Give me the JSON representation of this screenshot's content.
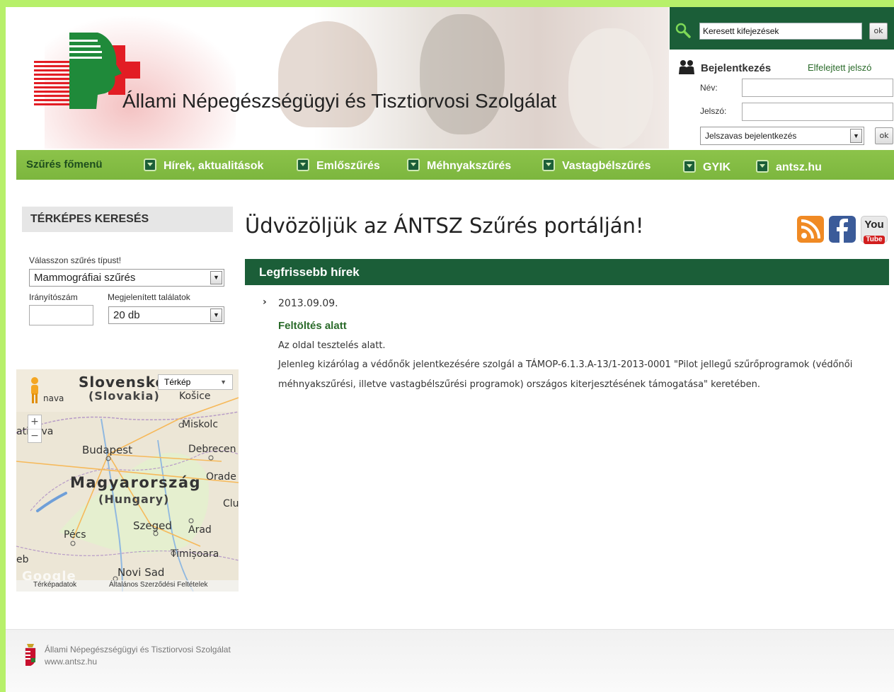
{
  "header": {
    "title": "Állami Népegészségügyi és Tisztiorvosi Szolgálat"
  },
  "search": {
    "value": "Keresett kifejezések",
    "button": "ok"
  },
  "login": {
    "title": "Bejelentkezés",
    "forgot_link": "Elfelejtett jelszó",
    "name_label": "Név:",
    "password_label": "Jelszó:",
    "method_selected": "Jelszavas bejelentkezés",
    "button": "ok"
  },
  "nav": {
    "main_label": "Szűrés főmenü",
    "items": [
      {
        "label": "Hírek, aktualitások"
      },
      {
        "label": "Emlőszűrés"
      },
      {
        "label": "Méhnyakszűrés"
      },
      {
        "label": "Vastagbélszűrés"
      },
      {
        "label": "GYIK"
      },
      {
        "label": "antsz.hu"
      }
    ]
  },
  "sidebar": {
    "title": "TÉRKÉPES KERESÉS",
    "type_label": "Válasszon szűrés típust!",
    "type_selected": "Mammográfiai szűrés",
    "zip_label": "Irányítószám",
    "results_label": "Megjelenített találatok",
    "results_selected": "20 db"
  },
  "map": {
    "type_selected": "Térkép",
    "zoom_in": "+",
    "zoom_out": "−",
    "labels": {
      "slovakia": "Slovensko",
      "slovakia_en": "(Slovakia)",
      "kosice": "Košice",
      "nava": "nava",
      "atava": "ati  ava",
      "miskolc": "Miskolc",
      "budapest": "Budapest",
      "debrecen": "Debrecen",
      "oradea": "Orade",
      "hungary": "Magyarország",
      "hungary_en": "(Hungary)",
      "cluj": "Clu",
      "szeged": "Szeged",
      "arad": "Arad",
      "pecs": "Pécs",
      "timisoara": "Timișoara",
      "eb": "eb",
      "novisad": "Novi Sad",
      "google": "Google"
    },
    "footer_data": "Térképadatok",
    "footer_terms": "Általános Szerződési Feltételek"
  },
  "main": {
    "welcome": "Üdvözöljük az ÁNTSZ Szűrés portálján!",
    "news_header": "Legfrissebb hírek",
    "news": {
      "date": "2013.09.09.",
      "title": "Feltöltés alatt",
      "line1": "Az oldal tesztelés alatt.",
      "line2": "Jelenleg kizárólag a védőnők jelentkezésére szolgál a TÁMOP-6.1.3.A-13/1-2013-0001 \"Pilot jellegű szűrőprogramok (védőnői",
      "line3": "méhnyakszűrési, illetve vastagbélszűrési programok) országos kiterjesztésének támogatása\" keretében."
    },
    "social": {
      "youtube_top": "You",
      "youtube_bottom": "Tube"
    }
  },
  "footer": {
    "org": "Állami Népegészségügyi és Tisztiorvosi Szolgálat",
    "url": "www.antsz.hu"
  },
  "colors": {
    "brand_green": "#1b5e38",
    "nav_green": "#8cc34a",
    "outer_border": "#b7f06a",
    "logo_red": "#e21d24"
  }
}
